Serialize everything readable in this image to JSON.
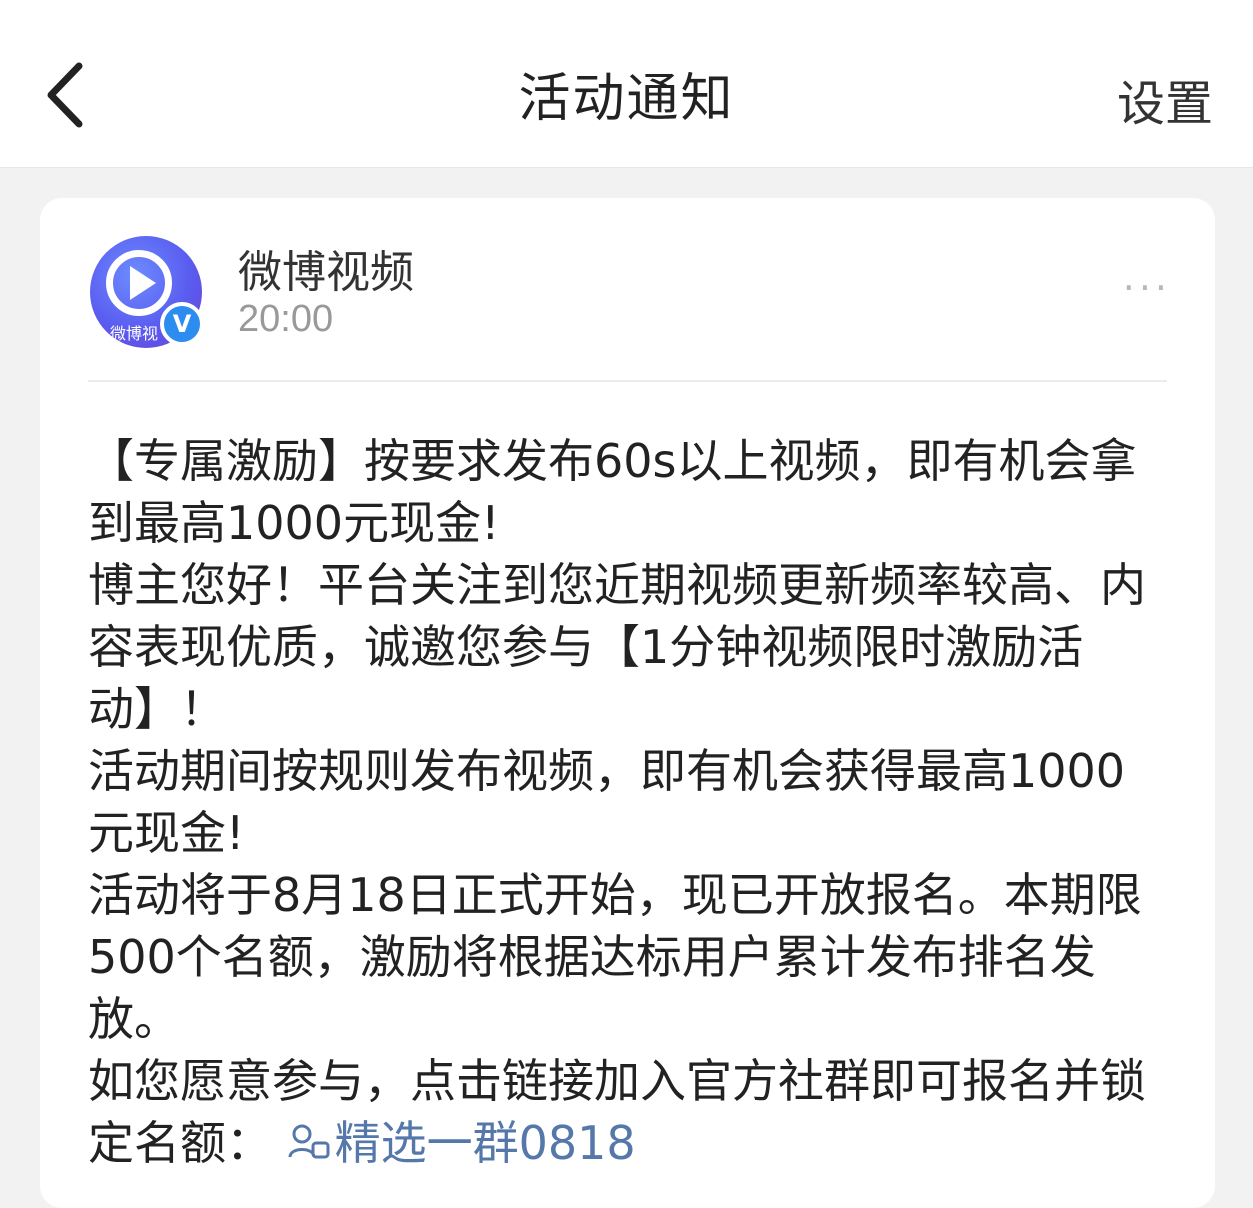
{
  "header": {
    "title": "活动通知",
    "settings_label": "设置",
    "back_icon": "chevron-left-icon"
  },
  "message_card": {
    "sender": {
      "name": "微博视频",
      "time": "20:00",
      "avatar_text": "微博视",
      "verified_mark": "V"
    },
    "more_label": "···",
    "paragraphs": [
      "【专属激励】按要求发布60s以上视频，即有机会拿到最高1000元现金!",
      "博主您好！平台关注到您近期视频更新频率较高、内容表现优质，诚邀您参与【1分钟视频限时激励活动】！",
      "活动期间按规则发布视频，即有机会获得最高1000元现金!",
      "活动将于8月18日正式开始，现已开放报名。本期限500个名额，激励将根据达标用户累计发布排名发放。"
    ],
    "signup_prefix": "如您愿意参与，点击链接加入官方社群即可报名并锁定名额：",
    "group_link_label": "精选一群0818",
    "group_link_icon": "group-chat-icon"
  },
  "colors": {
    "link": "#5577aa",
    "verified": "#2d8cf0",
    "background": "#f2f2f2"
  }
}
